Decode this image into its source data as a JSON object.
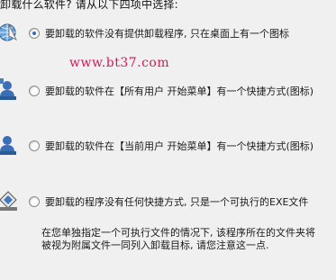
{
  "header": {
    "text": "卸载什么软件? 请从以下四项中选择:"
  },
  "options": [
    {
      "label": "要卸载的软件没有提供卸载程序, 只在桌面上有一个图标",
      "checked": true,
      "icon": "globe-icon"
    },
    {
      "label": "要卸载的软件在【所有用户  开始菜单】有一个快捷方式(图标)",
      "checked": false,
      "icon": "users-icon"
    },
    {
      "label": "要卸载的软件在【当前用户  开始菜单】有一个快捷方式(图标)",
      "checked": false,
      "icon": "user-icon"
    },
    {
      "label": "要卸载的程序没有任何快捷方式, 只是一个可执行的EXE文件",
      "checked": false,
      "icon": "exe-icon"
    }
  ],
  "watermark": "www.bt37.com",
  "note": {
    "line1": "在您单独指定一个可执行文件的情况下, 该程序所在的文件夹将",
    "line2": "被视为附属文件一同列入卸载目标, 请您注意这一点."
  }
}
